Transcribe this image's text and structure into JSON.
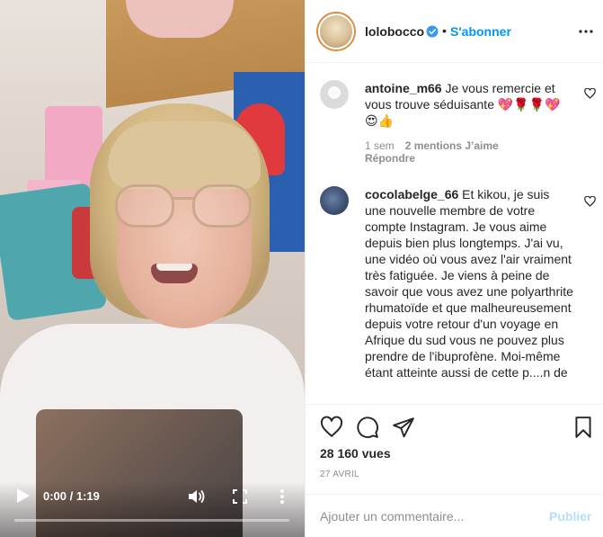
{
  "video": {
    "time": "0:00 / 1:19",
    "progress": 0.0,
    "controls": {
      "play_icon": "play-icon",
      "volume_icon": "volume-icon",
      "fullscreen_icon": "fullscreen-icon",
      "more_icon": "more-vertical-icon"
    }
  },
  "header": {
    "username": "lolobocco",
    "separator": "•",
    "follow_label": "S'abonner",
    "more_icon": "more-horizontal-icon",
    "verified_icon": "verified-badge-icon"
  },
  "comments": [
    {
      "username": "antoine_m66",
      "text": "Je vous remercie et vous trouve séduisante 💖🌹🌹💖😍👍",
      "time": "1 sem",
      "likes": "2 mentions J’aime",
      "reply": "Répondre"
    },
    {
      "username": "cocolabelge_66",
      "text": "Et kikou, je suis une nouvelle membre de votre compte Instagram. Je vous aime depuis bien plus longtemps. J'ai vu, une vidéo où vous avez l'air vraiment très fatiguée. Je viens à peine de savoir que vous avez une polyarthrite rhumatoïde et que malheureusement depuis votre retour d'un voyage en Afrique du sud vous ne pouvez plus prendre de l'ibuprofène. Moi-même étant atteinte aussi de cette p....n de"
    }
  ],
  "actions": {
    "views": "28 160 vues",
    "date": "27 AVRIL"
  },
  "add_comment": {
    "placeholder": "Ajouter un commentaire...",
    "publish_label": "Publier"
  },
  "colors": {
    "accent": "#0095f6",
    "publish_disabled": "#b2dffc",
    "muted": "#8e8e8e"
  }
}
